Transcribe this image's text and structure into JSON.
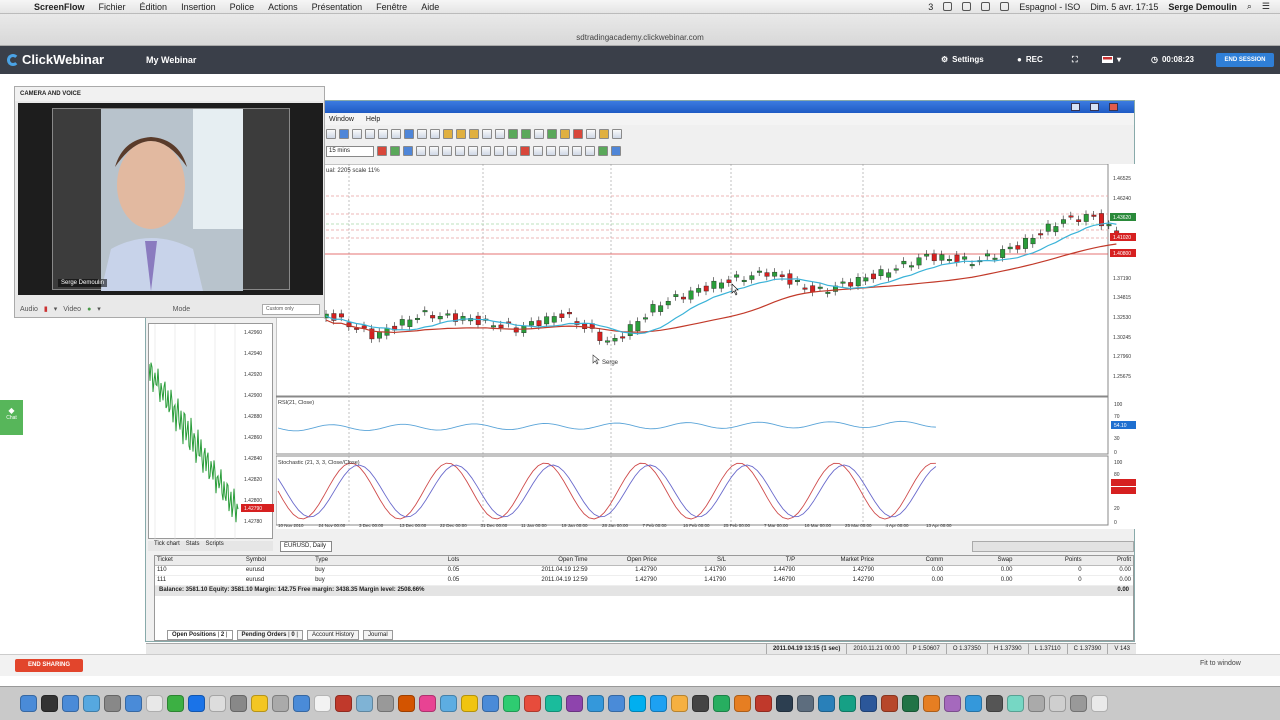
{
  "menubar": {
    "apple": "",
    "app": "ScreenFlow",
    "items": [
      "Fichier",
      "Édition",
      "Insertion",
      "Police",
      "Actions",
      "Présentation",
      "Fenêtre",
      "Aide"
    ],
    "badge": "3",
    "keyboard": "Espagnol - ISO",
    "datetime": "Dim. 5 avr.  17:15",
    "user": "Serge Demoulin"
  },
  "browser": {
    "url": "sdtradingacademy.clickwebinar.com"
  },
  "webinar": {
    "logo": "ClickWebinar",
    "title": "My Webinar",
    "settings": "Settings",
    "rec": "REC",
    "timer": "00:08:23",
    "end_session": "END SESSION",
    "end_sharing": "END SHARING",
    "fit_window": "Fit to window",
    "chat": "Chat"
  },
  "camera": {
    "header": "CAMERA AND VOICE",
    "name_tag": "Serge Demoulin",
    "audio_label": "Audio",
    "video_label": "Video",
    "mode_label": "Mode",
    "mode_value": "Custom only"
  },
  "metatrader": {
    "menu": [
      "Window",
      "Help"
    ],
    "timeframe": "15 mins",
    "chart_info": "ual: 2205  scale 11%",
    "price_labels": [
      "1.46525",
      "1.46240",
      "1.43620",
      "1.41020",
      "1.40800",
      "1.37190",
      "1.34815",
      "1.32530",
      "1.30245",
      "1.27960",
      "1.25675"
    ],
    "rsi_label": "RSI(21, Close)",
    "rsi_levels": [
      "100",
      "70",
      "30",
      "0"
    ],
    "rsi_value": "54.10",
    "stoch_label": "Stochastic (21, 3, 3, Close/Close)",
    "stoch_levels": [
      "100",
      "80",
      "20",
      "0"
    ],
    "date_labels": [
      "10 Nov 2010",
      "24 Nov 00:00",
      "3 Dec 00:00",
      "13 Dec 00:00",
      "22 Dec 00:00",
      "31 Dec 00:00",
      "11 Jan 00:00",
      "19 Jan 00:00",
      "28 Jan 00:00",
      "7 Feb 00:00",
      "16 Feb 00:00",
      "25 Feb 00:00",
      "7 Mar 00:00",
      "16 Mar 00:00",
      "25 Mar 00:00",
      "4 Apr 00:00",
      "13 Apr 00:00"
    ],
    "cursor_label": "Serge",
    "chart_tab": "EURUSD, Daily",
    "mini_tabs": [
      "Tick chart",
      "Stats",
      "Scripts"
    ],
    "mini_prices": [
      "1.42960",
      "1.42940",
      "1.42920",
      "1.42900",
      "1.42880",
      "1.42860",
      "1.42840",
      "1.42820",
      "1.42800",
      "1.42780"
    ],
    "mini_tag": "1.42790"
  },
  "terminal": {
    "headers": [
      "Ticket",
      "Symbol",
      "Type",
      "Lots",
      "Open Time",
      "Open Price",
      "S/L",
      "T/P",
      "Market Price",
      "Comm",
      "Swap",
      "Points",
      "Profit"
    ],
    "rows": [
      [
        "110",
        "eurusd",
        "buy",
        "0.05",
        "2011.04.19 12:59",
        "1.42790",
        "1.41790",
        "1.44790",
        "1.42790",
        "0.00",
        "0.00",
        "0",
        "0.00"
      ],
      [
        "111",
        "eurusd",
        "buy",
        "0.05",
        "2011.04.19 12:59",
        "1.42790",
        "1.41790",
        "1.46790",
        "1.42790",
        "0.00",
        "0.00",
        "0",
        "0.00"
      ]
    ],
    "balance": "Balance: 3581.10  Equity: 3581.10  Margin: 142.75  Free margin: 3438.35  Margin level: 2508.66%",
    "balance_total": "0.00",
    "tabs": [
      "Open Positions",
      "2",
      "Pending Orders",
      "0",
      "Account History",
      "Journal"
    ]
  },
  "status": [
    "2011.04.19 13:15 (1 sec)",
    "2010.11.21 00:00",
    "P 1.50607",
    "O 1.37350",
    "H 1.37390",
    "L 1.37110",
    "C 1.37390",
    "V 143"
  ],
  "colors": {
    "header_bg": "#3a3f49",
    "accent_blue": "#2f7fd7",
    "danger_red": "#e2452c",
    "bull": "#2a9d3a",
    "bear": "#d62020",
    "ma_slow": "#c23a2a",
    "ma_fast": "#3bb3d8"
  }
}
